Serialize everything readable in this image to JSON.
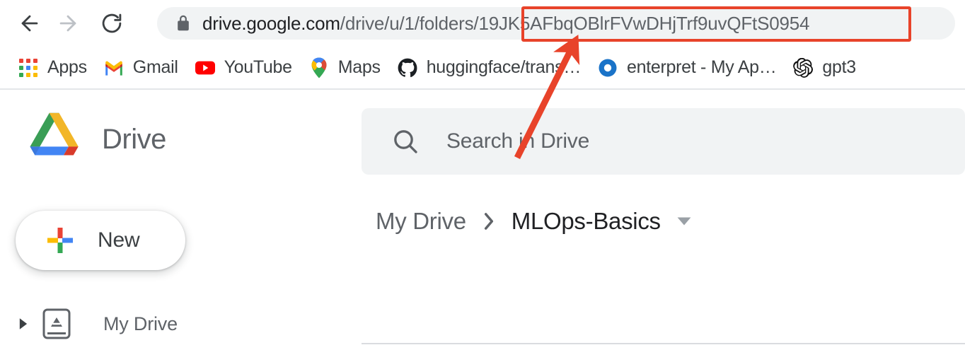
{
  "browser": {
    "nav": {
      "back_label": "Back",
      "forward_label": "Forward",
      "reload_label": "Reload"
    },
    "omnibox": {
      "lock_label": "Connection is secure",
      "url_host": "drive.google.com",
      "url_path": "/drive/u/1/folders/",
      "url_folder_id": "19JK5AFbqOBlrFVwDHjTrf9uvQFtS0954",
      "full_url": "drive.google.com/drive/u/1/folders/19JK5AFbqOBlrFVwDHjTrf9uvQFtS0954"
    },
    "bookmarks": [
      {
        "label": "Apps",
        "icon": "apps-grid-icon"
      },
      {
        "label": "Gmail",
        "icon": "gmail-icon"
      },
      {
        "label": "YouTube",
        "icon": "youtube-icon"
      },
      {
        "label": "Maps",
        "icon": "maps-icon"
      },
      {
        "label": "huggingface/trans…",
        "icon": "github-icon"
      },
      {
        "label": "enterpret - My Ap…",
        "icon": "enterpret-icon"
      },
      {
        "label": "gpt3",
        "icon": "openai-icon"
      }
    ]
  },
  "drive": {
    "logo_label": "Drive",
    "search": {
      "placeholder": "Search in Drive",
      "value": "",
      "icon": "search-icon"
    },
    "sidebar": {
      "new_button_label": "New",
      "items": [
        {
          "label": "My Drive",
          "icon": "my-drive-icon",
          "expanded": false
        }
      ]
    },
    "breadcrumb": {
      "root": "My Drive",
      "current": "MLOps-Basics",
      "separator": "›"
    }
  },
  "annotation": {
    "highlight_color": "#E8432A",
    "arrow_color": "#E8432A",
    "target": "url_folder_id"
  },
  "colors": {
    "google_blue": "#4285F4",
    "google_red": "#EA4335",
    "google_yellow": "#FBBC04",
    "google_green": "#34A853",
    "chrome_omnibox_bg": "#F1F3F4",
    "text_primary": "#202124",
    "text_secondary": "#5F6368",
    "divider": "#DADCE0"
  }
}
